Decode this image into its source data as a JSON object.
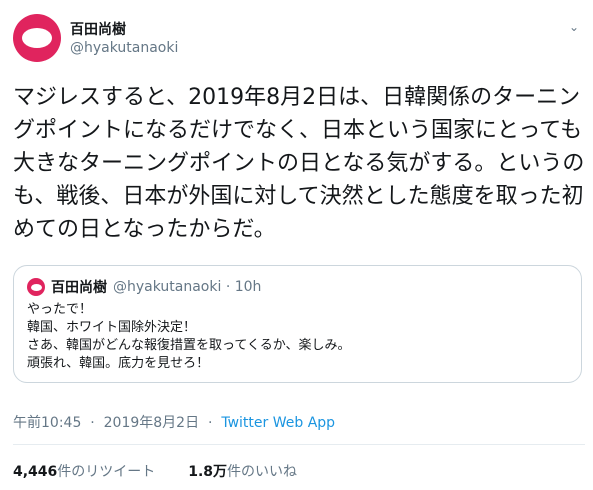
{
  "author": {
    "name": "百田尚樹",
    "handle": "@hyakutanaoki"
  },
  "tweet": {
    "text": "マジレスすると、2019年8月2日は、日韓関係のターニングポイントになるだけでなく、日本という国家にとっても大きなターニングポイントの日となる気がする。というのも、戦後、日本が外国に対して決然とした態度を取った初めての日となったからだ。",
    "time": "午前10:45",
    "date": "2019年8月2日",
    "separator": "·",
    "source": "Twitter Web App"
  },
  "quote": {
    "name": "百田尚樹",
    "handle": "@hyakutanaoki",
    "age": "10h",
    "separator": "·",
    "text": "やったで！\n韓国、ホワイト国除外決定！\nさあ、韓国がどんな報復措置を取ってくるか、楽しみ。\n頑張れ、韓国。底力を見せろ！"
  },
  "stats": {
    "retweet_count": "4,446",
    "retweet_label": "件のリツイート",
    "like_count": "1.8万",
    "like_label": "件のいいね"
  },
  "icons": {
    "menu": "chevron-down-icon",
    "avatar": "avatar-icon"
  },
  "colors": {
    "avatar": "#e0245e",
    "link": "#1b95e0",
    "muted": "#657786",
    "border": "#ccd6dd"
  }
}
